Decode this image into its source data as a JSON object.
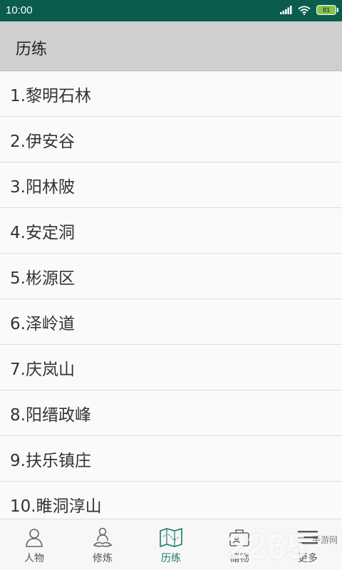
{
  "status_bar": {
    "time": "10:00",
    "battery": "81",
    "icons": [
      "signal-icon",
      "wifi-icon",
      "battery-icon"
    ]
  },
  "app_bar": {
    "title": "历练"
  },
  "list": {
    "items": [
      "1.黎明石林",
      "2.伊安谷",
      "3.阳林陂",
      "4.安定洞",
      "5.彬源区",
      "6.泽岭道",
      "7.庆岚山",
      "8.阳缙政峰",
      "9.扶乐镇庄",
      "10.睢洞淳山"
    ]
  },
  "bottom_nav": {
    "active": "历练",
    "active_color": "#1a7a6b",
    "items": [
      {
        "label": "人物",
        "icon": "person-icon"
      },
      {
        "label": "修炼",
        "icon": "meditation-icon"
      },
      {
        "label": "历练",
        "icon": "map-icon"
      },
      {
        "label": "储物",
        "icon": "inventory-icon"
      },
      {
        "label": "更多",
        "icon": "menu-icon"
      }
    ]
  },
  "watermark": {
    "logo": "2265",
    "text": "手游网"
  }
}
